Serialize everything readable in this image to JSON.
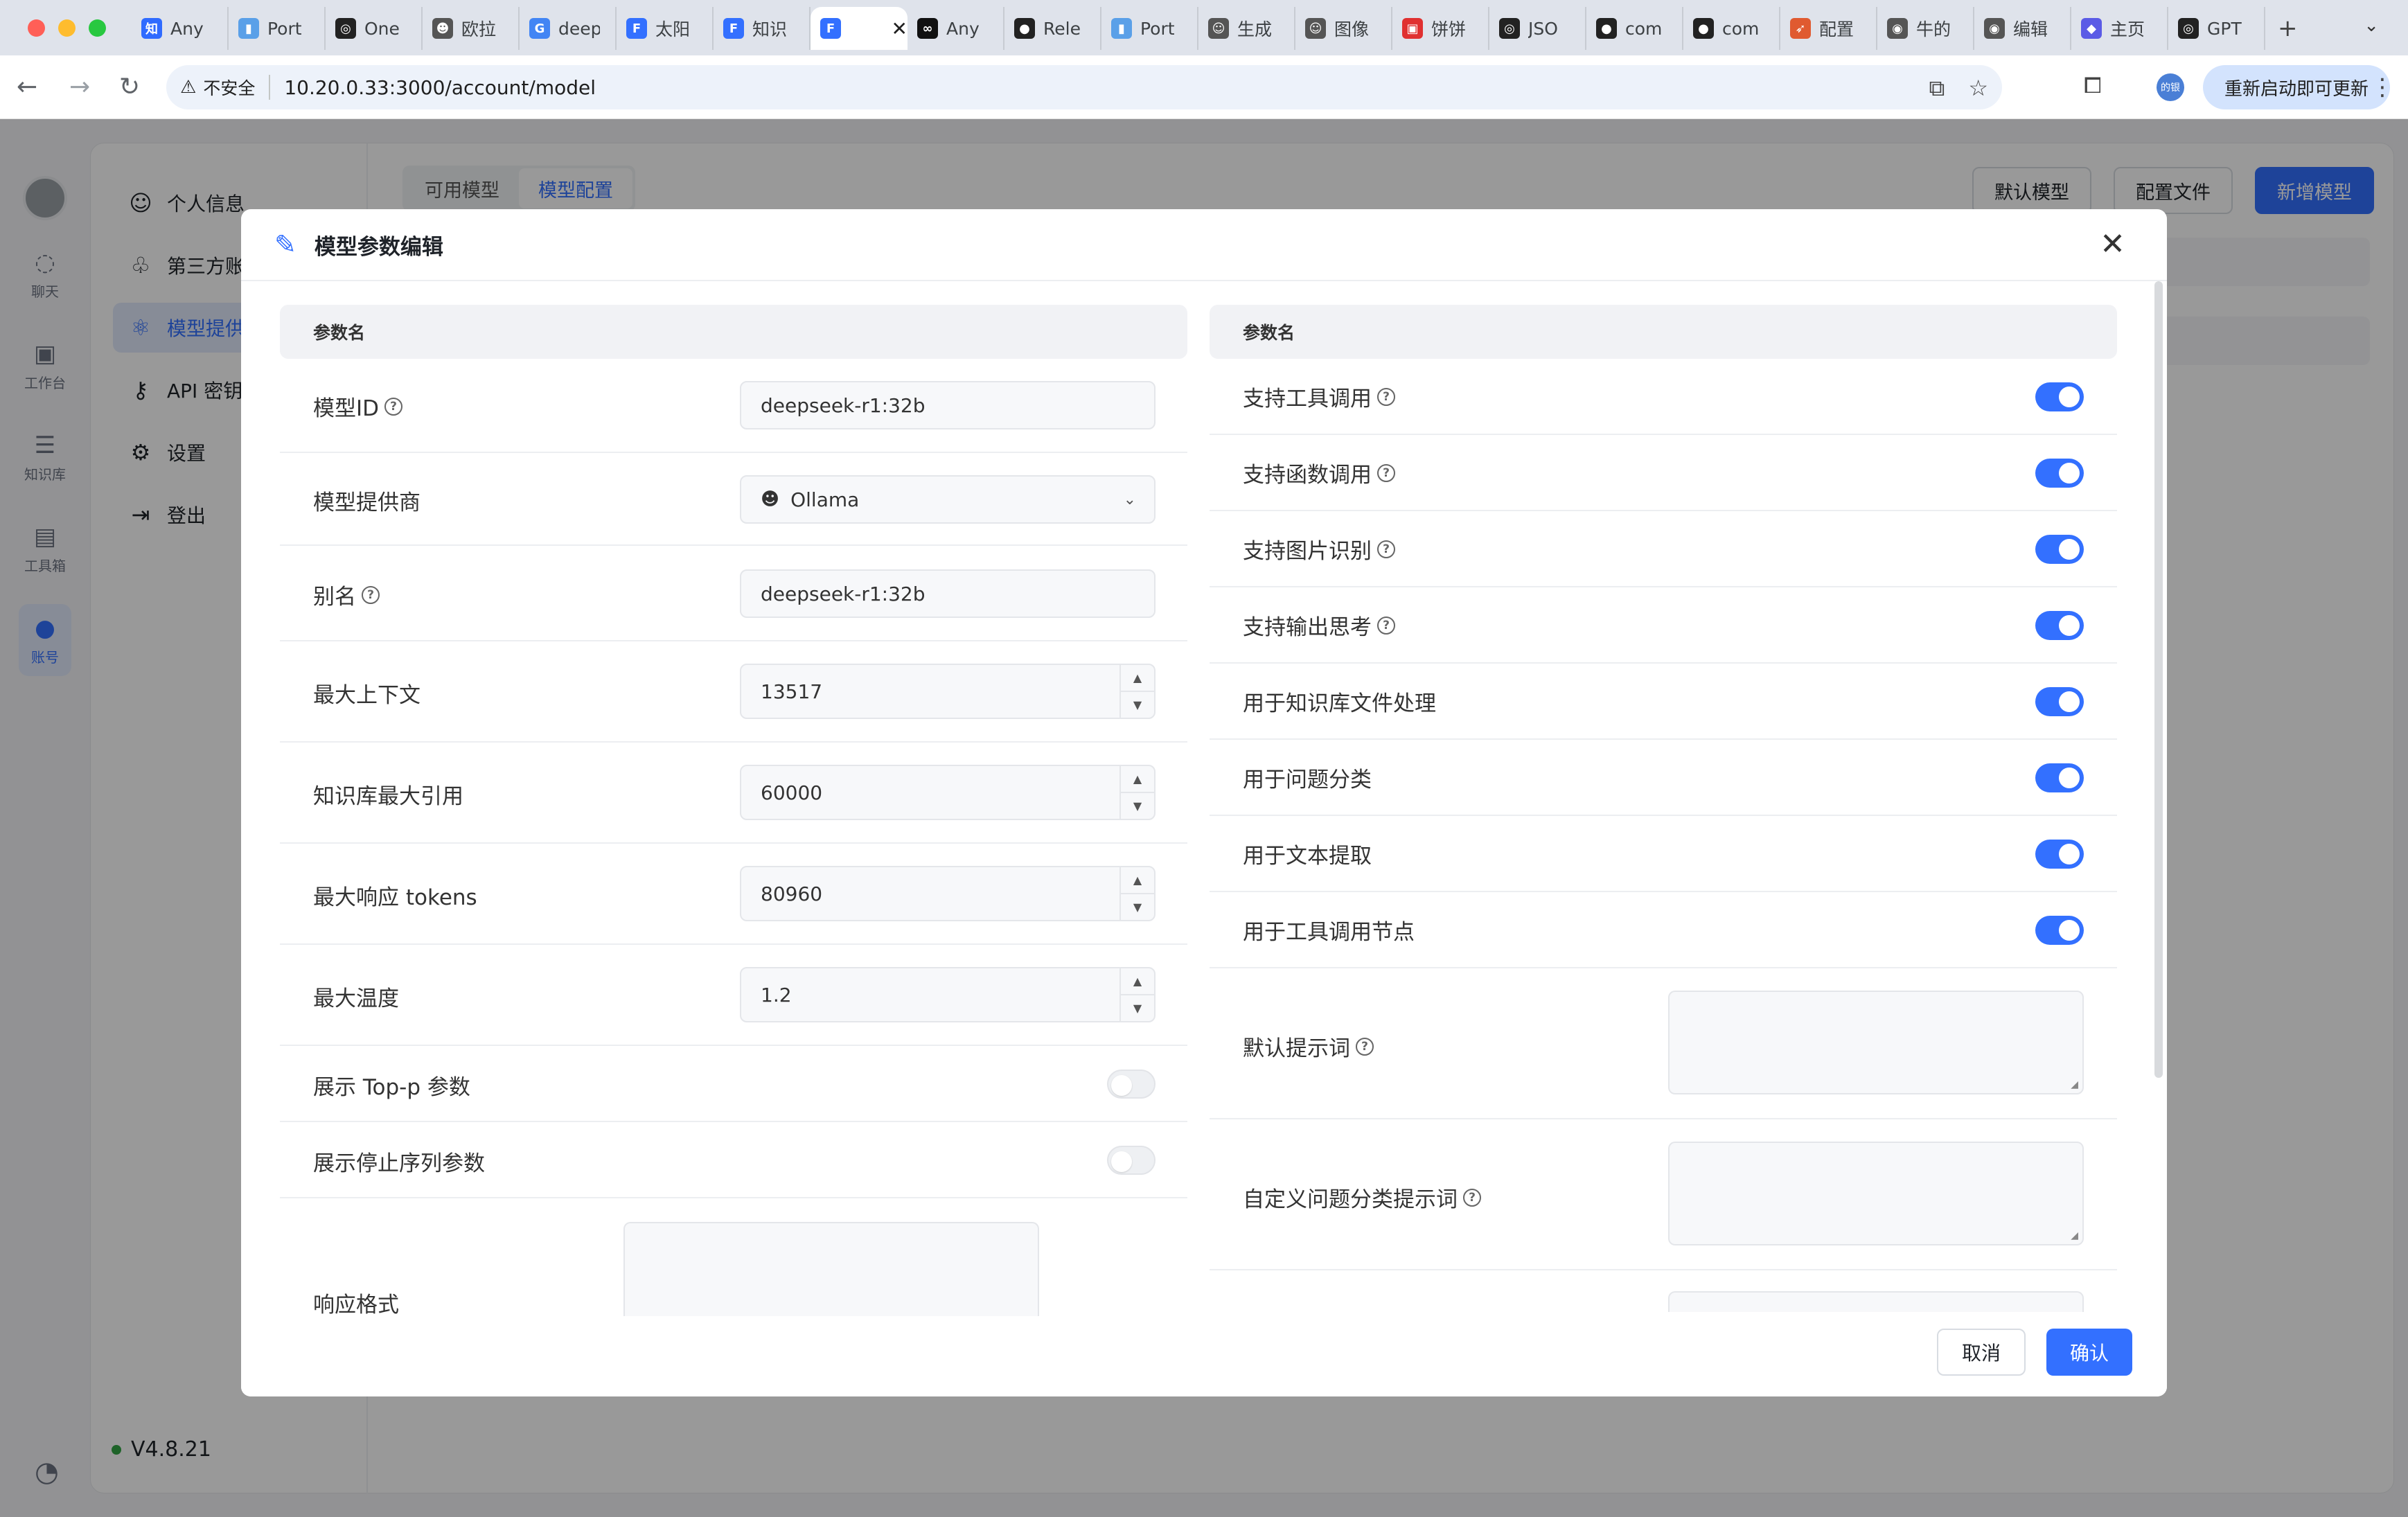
{
  "browser": {
    "tabs": [
      {
        "title": "Any",
        "fav": "知",
        "color": "#2f6bff"
      },
      {
        "title": "Port",
        "fav": "▮",
        "color": "#5aa0e8"
      },
      {
        "title": "One",
        "fav": "◎",
        "color": "#222222"
      },
      {
        "title": "欧拉",
        "fav": "☻",
        "color": "#555555"
      },
      {
        "title": "deep",
        "fav": "G",
        "color": "#4285f4"
      },
      {
        "title": "太阳",
        "fav": "F",
        "color": "#3370ff"
      },
      {
        "title": "知识",
        "fav": "F",
        "color": "#3370ff"
      },
      {
        "title": "",
        "fav": "F",
        "color": "#3370ff",
        "active": true
      },
      {
        "title": "Any",
        "fav": "∞",
        "color": "#111111"
      },
      {
        "title": "Rele",
        "fav": "●",
        "color": "#222222"
      },
      {
        "title": "Port",
        "fav": "▮",
        "color": "#5aa0e8"
      },
      {
        "title": "生成",
        "fav": "☺",
        "color": "#555555"
      },
      {
        "title": "图像",
        "fav": "☺",
        "color": "#555555"
      },
      {
        "title": "饼饼",
        "fav": "▣",
        "color": "#e03030"
      },
      {
        "title": "JSO",
        "fav": "◎",
        "color": "#222222"
      },
      {
        "title": "com",
        "fav": "●",
        "color": "#222222"
      },
      {
        "title": "com",
        "fav": "●",
        "color": "#222222"
      },
      {
        "title": "配置",
        "fav": "➶",
        "color": "#e05a30"
      },
      {
        "title": "牛的",
        "fav": "◉",
        "color": "#555555"
      },
      {
        "title": "编辑",
        "fav": "◉",
        "color": "#555555"
      },
      {
        "title": "主页",
        "fav": "◆",
        "color": "#5b5be6"
      },
      {
        "title": "GPT",
        "fav": "◎",
        "color": "#222222"
      }
    ],
    "new_tab": "+",
    "insecure_label": "不安全",
    "url": "10.20.0.33:3000/account/model",
    "profile_label": "的银",
    "update_label": "重新启动即可更新"
  },
  "left_nav": [
    {
      "label": "聊天",
      "icon": "◌"
    },
    {
      "label": "工作台",
      "icon": "▣"
    },
    {
      "label": "知识库",
      "icon": "☰"
    },
    {
      "label": "工具箱",
      "icon": "▤"
    },
    {
      "label": "账号",
      "icon": "●",
      "active": true
    }
  ],
  "side_menu": [
    {
      "label": "个人信息",
      "icon": "☺"
    },
    {
      "label": "第三方账",
      "icon": "♧"
    },
    {
      "label": "模型提供",
      "icon": "⚛",
      "active": true
    },
    {
      "label": "API 密钥",
      "icon": "⚷"
    },
    {
      "label": "设置",
      "icon": "⚙"
    },
    {
      "label": "登出",
      "icon": "⇥"
    }
  ],
  "version": "V4.8.21",
  "content_tabs": [
    {
      "label": "可用模型"
    },
    {
      "label": "模型配置",
      "active": true
    }
  ],
  "top_actions": {
    "default_model": "默认模型",
    "config_file": "配置文件",
    "add_model": "新增模型"
  },
  "modal": {
    "title": "模型参数编辑",
    "left_header": "参数名",
    "right_header": "参数名",
    "fields": {
      "model_id": {
        "label": "模型ID",
        "value": "deepseek-r1:32b"
      },
      "provider": {
        "label": "模型提供商",
        "value": "Ollama"
      },
      "alias": {
        "label": "别名",
        "value": "deepseek-r1:32b"
      },
      "max_context": {
        "label": "最大上下文",
        "value": "13517"
      },
      "kb_max_quote": {
        "label": "知识库最大引用",
        "value": "60000"
      },
      "max_response_tokens": {
        "label": "最大响应 tokens",
        "value": "80960"
      },
      "max_temperature": {
        "label": "最大温度",
        "value": "1.2"
      },
      "show_top_p": {
        "label": "展示 Top-p 参数",
        "enabled": false
      },
      "show_stop_seq": {
        "label": "展示停止序列参数",
        "enabled": false
      },
      "response_format": {
        "label": "响应格式",
        "value": ""
      }
    },
    "switches": [
      {
        "label": "支持工具调用",
        "help": true,
        "enabled": true
      },
      {
        "label": "支持函数调用",
        "help": true,
        "enabled": true
      },
      {
        "label": "支持图片识别",
        "help": true,
        "enabled": true
      },
      {
        "label": "支持输出思考",
        "help": true,
        "enabled": true
      },
      {
        "label": "用于知识库文件处理",
        "help": false,
        "enabled": true
      },
      {
        "label": "用于问题分类",
        "help": false,
        "enabled": true
      },
      {
        "label": "用于文本提取",
        "help": false,
        "enabled": true
      },
      {
        "label": "用于工具调用节点",
        "help": false,
        "enabled": true
      }
    ],
    "prompts": {
      "default_prompt": {
        "label": "默认提示词",
        "value": ""
      },
      "custom_classify_prompt": {
        "label": "自定义问题分类提示词",
        "value": ""
      }
    },
    "cancel_label": "取消",
    "confirm_label": "确认"
  }
}
